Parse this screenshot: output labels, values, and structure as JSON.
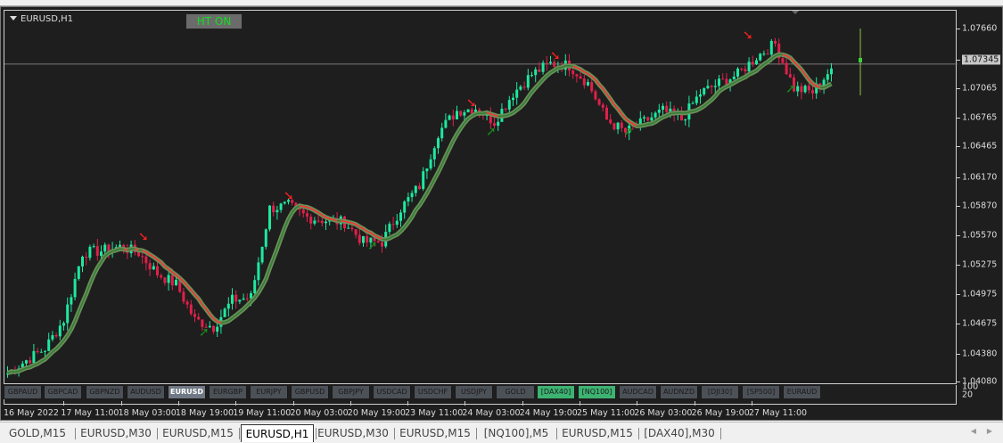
{
  "chart": {
    "title": "EURUSD,H1",
    "ht_button": "HT ON",
    "current_price": "1.07345",
    "price_labels": [
      "1.07660",
      "1.07345",
      "1.07065",
      "1.06765",
      "1.06465",
      "1.06170",
      "1.05870",
      "1.05570",
      "1.05275",
      "1.04975",
      "1.04675",
      "1.04380",
      "1.04080"
    ],
    "sub_labels": [
      "100",
      "20"
    ],
    "date_labels": [
      "16 May 2022",
      "17 May 11:00",
      "18 May 03:00",
      "18 May 19:00",
      "19 May 11:00",
      "20 May 03:00",
      "20 May 19:00",
      "23 May 11:00",
      "24 May 03:00",
      "24 May 19:00",
      "25 May 11:00",
      "26 May 03:00",
      "26 May 19:00",
      "27 May 11:00"
    ],
    "symbols": [
      {
        "label": "GBPAUD",
        "state": "normal"
      },
      {
        "label": "GBPCAD",
        "state": "normal"
      },
      {
        "label": "GBPNZD",
        "state": "normal"
      },
      {
        "label": "AUDUSD",
        "state": "normal"
      },
      {
        "label": "EURUSD",
        "state": "active"
      },
      {
        "label": "EURGBP",
        "state": "normal"
      },
      {
        "label": "EURJPY",
        "state": "normal"
      },
      {
        "label": "GBPUSD",
        "state": "normal"
      },
      {
        "label": "GBPJPY",
        "state": "normal"
      },
      {
        "label": "USDCAD",
        "state": "normal"
      },
      {
        "label": "USDCHF",
        "state": "normal"
      },
      {
        "label": "USDJPY",
        "state": "normal"
      },
      {
        "label": "GOLD",
        "state": "normal"
      },
      {
        "label": "[DAX40]",
        "state": "green"
      },
      {
        "label": "[NQ100]",
        "state": "green"
      },
      {
        "label": "AUDCAD",
        "state": "normal"
      },
      {
        "label": "AUDNZD",
        "state": "normal"
      },
      {
        "label": "[DJI30]",
        "state": "normal"
      },
      {
        "label": "[SP500]",
        "state": "normal"
      },
      {
        "label": "EURAUD",
        "state": "normal"
      }
    ]
  },
  "tabs": [
    "GOLD,M15",
    "EURUSD,M30",
    "EURUSD,M15",
    "EURUSD,H1",
    "EURUSD,M30",
    "EURUSD,M15",
    "[NQ100],M5",
    "EURUSD,M15",
    "[DAX40],M30"
  ],
  "active_tab": "EURUSD,H1",
  "colors": {
    "bull": "#1de9a0",
    "bear": "#e0204a",
    "band": "#6b8f5a",
    "arrow_up": "#1a8a1a",
    "arrow_down": "#ff2020",
    "background": "#1e1e1e"
  },
  "chart_data": {
    "type": "candlestick",
    "symbol": "EURUSD",
    "timeframe": "H1",
    "ylim": [
      1.0408,
      1.0766
    ],
    "closes": [
      1.0421,
      1.0434,
      1.0446,
      1.0475,
      1.0543,
      1.0545,
      1.0549,
      1.0543,
      1.0522,
      1.0511,
      1.0475,
      1.0468,
      1.0495,
      1.0498,
      1.0588,
      1.0591,
      1.0579,
      1.0576,
      1.0574,
      1.0554,
      1.0554,
      1.0588,
      1.0611,
      1.0665,
      1.0687,
      1.069,
      1.0676,
      1.0705,
      1.0724,
      1.0735,
      1.0733,
      1.0715,
      1.0678,
      1.0665,
      1.0676,
      1.0687,
      1.0678,
      1.0705,
      1.0715,
      1.0724,
      1.0742,
      1.0755,
      1.071,
      1.0706,
      1.073
    ],
    "current_price": 1.07345
  }
}
